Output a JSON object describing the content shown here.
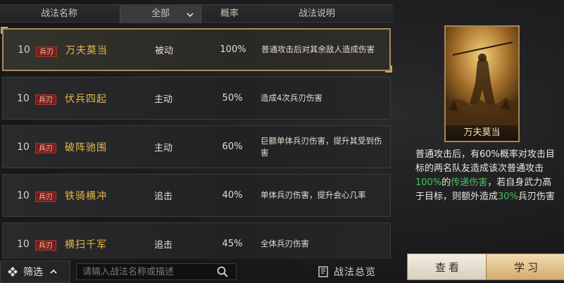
{
  "header": {
    "col_name": "战法名称",
    "col_type_filter": "全部",
    "col_probability": "概率",
    "col_description": "战法说明"
  },
  "skills": [
    {
      "level": "10",
      "tag": "兵刃",
      "name": "万夫莫当",
      "type": "被动",
      "probability": "100%",
      "description": "普通攻击后对其余敌人造成伤害",
      "selected": true
    },
    {
      "level": "10",
      "tag": "兵刃",
      "name": "伏兵四起",
      "type": "主动",
      "probability": "50%",
      "description": "造成4次兵刃伤害",
      "selected": false
    },
    {
      "level": "10",
      "tag": "兵刃",
      "name": "破阵驰围",
      "type": "主动",
      "probability": "60%",
      "description": "巨额单体兵刃伤害，提升其受到伤害",
      "selected": false
    },
    {
      "level": "10",
      "tag": "兵刃",
      "name": "铁骑横冲",
      "type": "追击",
      "probability": "40%",
      "description": "单体兵刃伤害，提升会心几率",
      "selected": false
    },
    {
      "level": "10",
      "tag": "兵刃",
      "name": "横扫千军",
      "type": "追击",
      "probability": "45%",
      "description": "全体兵刃伤害",
      "selected": false
    }
  ],
  "bottom": {
    "filter_label": "筛选",
    "search_placeholder": "请输入战法名称或描述",
    "overview_label": "战法总览"
  },
  "detail": {
    "card_name": "万夫莫当",
    "text_part1": "普通攻击后，有60%概率对攻击目标的两名队友造成该次普通攻击",
    "text_hl1": "100%",
    "text_part2": "的",
    "text_hl2": "传递伤害",
    "text_part3": "，若自身武力高于目标，则额外造成",
    "text_hl3": "30%",
    "text_part4": "兵刃伤害"
  },
  "buttons": {
    "view": "查看",
    "learn": "学习"
  },
  "colors": {
    "skill_name": "#e5b94a",
    "highlight_green": "#49c25a",
    "tag_bg": "#7a1e1a",
    "selected_border": "#a88c57"
  }
}
